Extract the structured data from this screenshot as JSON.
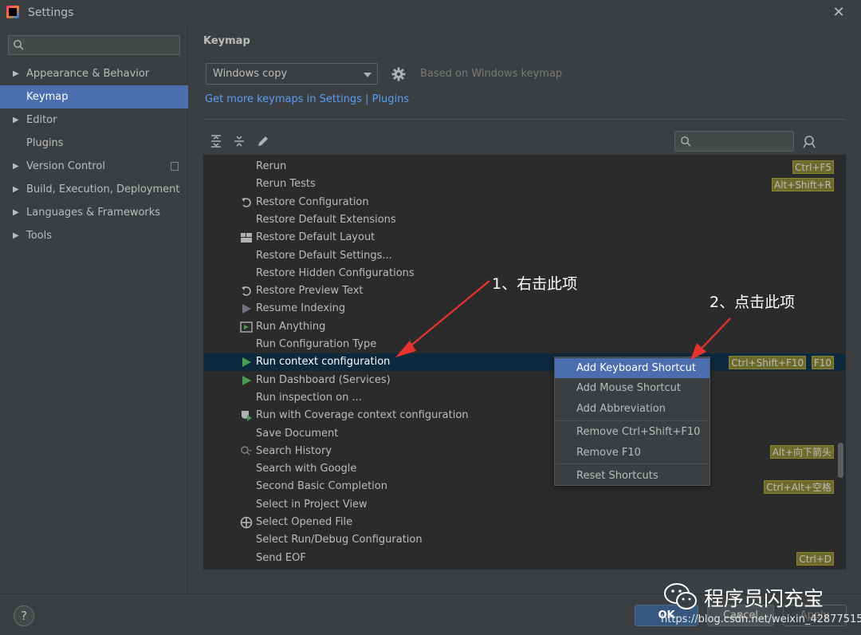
{
  "window": {
    "title": "Settings",
    "close_glyph": "✕"
  },
  "sidebar": {
    "search_placeholder": "",
    "items": [
      {
        "label": "Appearance & Behavior",
        "expandable": true
      },
      {
        "label": "Keymap",
        "expandable": false,
        "selected": true
      },
      {
        "label": "Editor",
        "expandable": true
      },
      {
        "label": "Plugins",
        "expandable": false
      },
      {
        "label": "Version Control",
        "expandable": true
      },
      {
        "label": "Build, Execution, Deployment",
        "expandable": true
      },
      {
        "label": "Languages & Frameworks",
        "expandable": true
      },
      {
        "label": "Tools",
        "expandable": true
      }
    ]
  },
  "keymap": {
    "heading": "Keymap",
    "selected_keymap": "Windows copy",
    "based_on": "Based on Windows keymap",
    "get_more_link": "Get more keymaps in Settings | Plugins",
    "tree_search_placeholder": ""
  },
  "actions": [
    {
      "label": "Rerun",
      "icon": "",
      "shortcuts": [
        "Ctrl+F5"
      ]
    },
    {
      "label": "Rerun Tests",
      "icon": "",
      "shortcuts": [
        "Alt+Shift+R"
      ]
    },
    {
      "label": "Restore Configuration",
      "icon": "undo-icon",
      "shortcuts": []
    },
    {
      "label": "Restore Default Extensions",
      "icon": "",
      "shortcuts": []
    },
    {
      "label": "Restore Default Layout",
      "icon": "layout-icon",
      "shortcuts": []
    },
    {
      "label": "Restore Default Settings...",
      "icon": "",
      "shortcuts": []
    },
    {
      "label": "Restore Hidden Configurations",
      "icon": "",
      "shortcuts": []
    },
    {
      "label": "Restore Preview Text",
      "icon": "undo-icon",
      "shortcuts": []
    },
    {
      "label": "Resume Indexing",
      "icon": "play-gray-icon",
      "shortcuts": []
    },
    {
      "label": "Run Anything",
      "icon": "run-anything-icon",
      "shortcuts": []
    },
    {
      "label": "Run Configuration Type",
      "icon": "",
      "shortcuts": []
    },
    {
      "label": "Run context configuration",
      "icon": "run-green-icon",
      "shortcuts": [
        "Ctrl+Shift+F10",
        "F10"
      ],
      "selected": true
    },
    {
      "label": "Run Dashboard (Services)",
      "icon": "run-green-icon",
      "shortcuts": []
    },
    {
      "label": "Run inspection on ...",
      "icon": "",
      "shortcuts": []
    },
    {
      "label": "Run with Coverage context configuration",
      "icon": "coverage-icon",
      "shortcuts": []
    },
    {
      "label": "Save Document",
      "icon": "",
      "shortcuts": []
    },
    {
      "label": "Search History",
      "icon": "search-history-icon",
      "shortcuts": [
        "Alt+向下箭头"
      ]
    },
    {
      "label": "Search with Google",
      "icon": "",
      "shortcuts": []
    },
    {
      "label": "Second Basic Completion",
      "icon": "",
      "shortcuts": [
        "Ctrl+Alt+空格"
      ]
    },
    {
      "label": "Select in Project View",
      "icon": "",
      "shortcuts": []
    },
    {
      "label": "Select Opened File",
      "icon": "crosshair-icon",
      "shortcuts": []
    },
    {
      "label": "Select Run/Debug Configuration",
      "icon": "",
      "shortcuts": []
    },
    {
      "label": "Send EOF",
      "icon": "",
      "shortcuts": [
        "Ctrl+D"
      ]
    }
  ],
  "context_menu": {
    "items": [
      "Add Keyboard Shortcut",
      "Add Mouse Shortcut",
      "Add Abbreviation",
      "Remove Ctrl+Shift+F10",
      "Remove F10",
      "Reset Shortcuts"
    ],
    "active": "Add Keyboard Shortcut"
  },
  "annotations": {
    "step1": "1、右击此项",
    "step2": "2、点击此项",
    "arrow_color": "#e8322f"
  },
  "footer": {
    "help": "?",
    "ok": "OK",
    "cancel": "Cancel",
    "apply": "Apply",
    "watermark_name": "程序员闪充宝",
    "watermark_url": "https://blog.csdn.net/weixin_42877515"
  },
  "colors": {
    "accent": "#4b6eaf",
    "link": "#589df6",
    "badge": "#6e6a2c",
    "selected_row": "#0d293e"
  }
}
